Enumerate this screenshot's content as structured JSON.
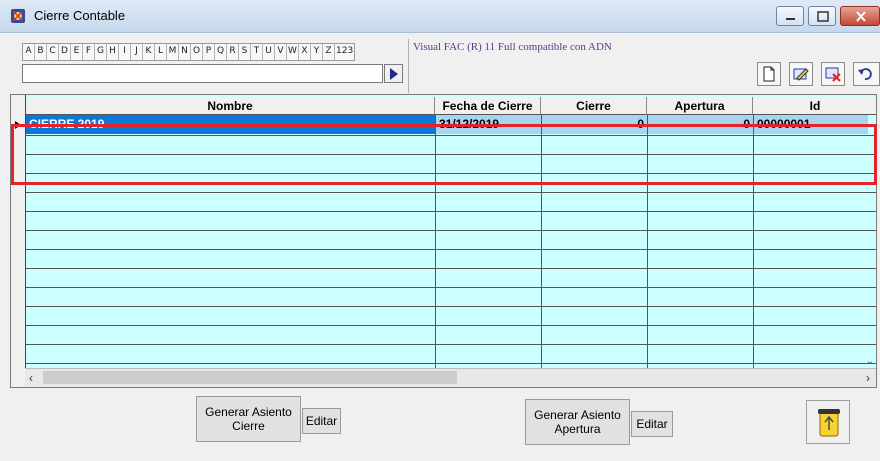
{
  "window": {
    "title": "Cierre Contable"
  },
  "alphabet": [
    "A",
    "B",
    "C",
    "D",
    "E",
    "F",
    "G",
    "H",
    "I",
    "J",
    "K",
    "L",
    "M",
    "N",
    "O",
    "P",
    "Q",
    "R",
    "S",
    "T",
    "U",
    "V",
    "W",
    "X",
    "Y",
    "Z",
    "123"
  ],
  "search": {
    "value": ""
  },
  "brand_text": "Visual FAC (R) 11 Full compatible con ADN",
  "toolbar": {
    "icons": [
      "new-document-icon",
      "edit-icon",
      "delete-icon",
      "undo-icon"
    ]
  },
  "grid": {
    "columns": [
      "Nombre",
      "Fecha de Cierre",
      "Cierre",
      "Apertura",
      "Id"
    ],
    "rows": [
      {
        "nombre": "CIERRE 2019",
        "fecha": "31/12/2019",
        "cierre": "0",
        "apertura": "0",
        "id": "00000001"
      }
    ]
  },
  "buttons": {
    "generar_cierre": "Generar Asiento Cierre",
    "editar1": "Editar",
    "generar_apertura": "Generar Asiento Apertura",
    "editar2": "Editar",
    "trash_icon": "recycle-bin-icon"
  },
  "colors": {
    "grid_bg": "#ccffff",
    "selected_cell": "#0b78d7",
    "row_cell": "#a8d4f0",
    "highlight": "#e3222b"
  }
}
